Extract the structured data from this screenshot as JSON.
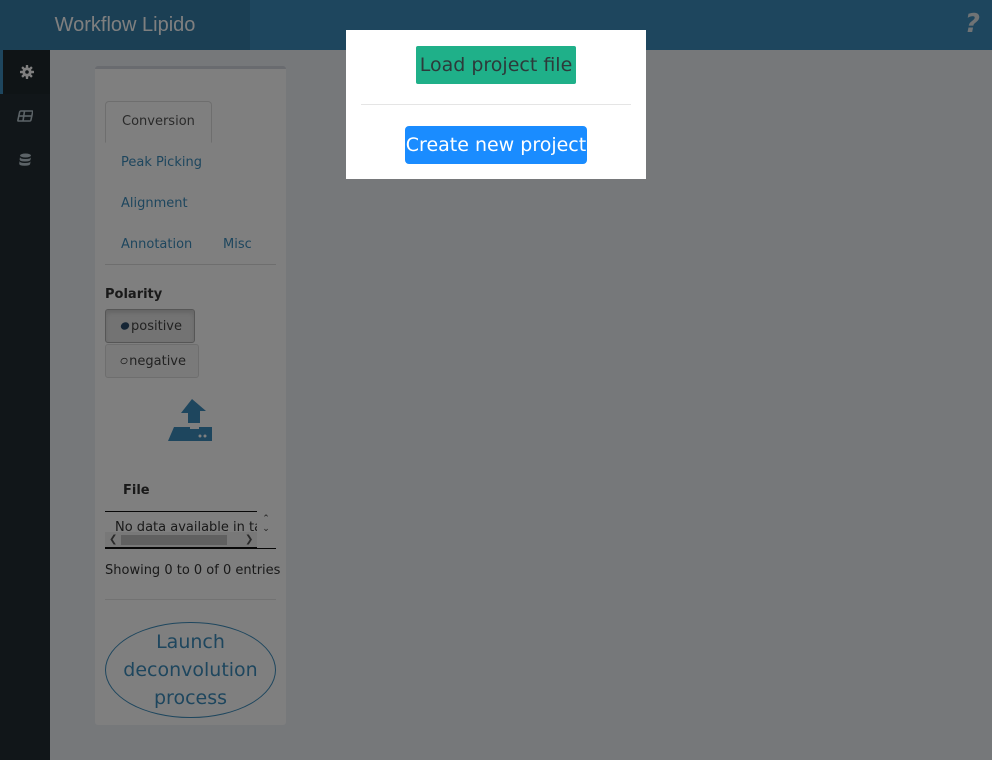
{
  "header": {
    "title": "Workflow Lipido",
    "help_icon": "question-icon"
  },
  "sidebar": {
    "items": [
      {
        "icon": "gear-icon",
        "active": true
      },
      {
        "icon": "table-icon",
        "active": false
      },
      {
        "icon": "database-icon",
        "active": false
      }
    ]
  },
  "tabs": [
    {
      "label": "Conversion",
      "active": true
    },
    {
      "label": "Peak Picking",
      "active": false
    },
    {
      "label": "Alignment",
      "active": false
    },
    {
      "label": "Annotation",
      "active": false
    },
    {
      "label": "Misc",
      "active": false
    }
  ],
  "polarity": {
    "label": "Polarity",
    "options": [
      {
        "label": "positive",
        "selected": true
      },
      {
        "label": "negative",
        "selected": false
      }
    ]
  },
  "file_table": {
    "column": "File",
    "empty_text": "No data available in table",
    "info": "Showing 0 to 0 of 0 entries"
  },
  "launch_button": "Launch deconvolution process",
  "modal": {
    "load_label": "Load project file",
    "create_label": "Create new project"
  },
  "colors": {
    "header": "#3c8dbc",
    "logo_bg": "#367fa9",
    "sidebar": "#222d32",
    "load_button": "#1fb089",
    "create_button": "#1a8cff"
  }
}
